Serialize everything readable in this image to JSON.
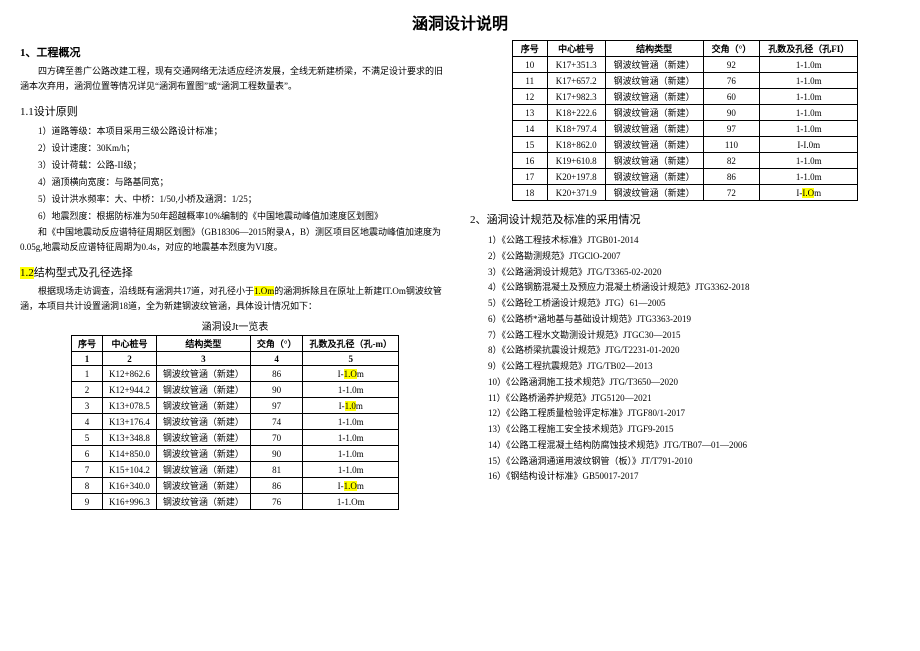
{
  "title": "涵洞设计说明",
  "left": {
    "sec1_h": "1、工程概况",
    "sec1_p1": "四方碑至善广公路改建工程，现有交通网络无法适应经济发展，全线无新建桥梁，不满足设计要求的旧涵本次弃用，涵洞位置等情况详见“涵洞布置图”或“涵洞工程数量表”。",
    "sec11_h": "1.1设计原则",
    "sec11_items": [
      "1）道路等级：本项目采用三级公路设计标准；",
      "2）设计速度：30Km/h；",
      "3）设计荷载：公路-II级；",
      "4）涵顶横向宽度：与路基同宽；",
      "5）设计洪水频率：大、中桥：1/50,小桥及涵洞：1/25；",
      "6）地震烈度：根据防标准为50年超越概率10%编制的《中国地震动峰值加速度区划图》"
    ],
    "sec11_p2": "和《中国地震动反应谱特征周期区划图》（GB18306—2015附录A，B）测区项目区地震动峰值加速度为0.05g,地震动反应谱特征周期为0.4s，对应的地震基本烈度为VI度。",
    "sec12_h_pre": "1.2",
    "sec12_h": "结构型式及孔径选择",
    "sec12_p": "根据现场走访调查，沿线既有涵洞共17道，对孔径小于",
    "sec12_p_hl": "1.Om",
    "sec12_p2": "的涵洞拆除且在原址上新建IT.Om钢波纹管涵，本项目共计设置涵洞18道，全为新建钢波纹管涵，具体设计情况如下：",
    "table1_title": "涵洞设Jt一览表",
    "table1_headers": [
      "序号",
      "中心桩号",
      "结构类型",
      "交角（°）",
      "孔数及孔径（孔-m）"
    ],
    "table1_sub": [
      "1",
      "2",
      "3",
      "4",
      "5"
    ],
    "table1_rows": [
      {
        "n": "1",
        "s": "K12+862.6",
        "t": "钢波纹管涵（新建）",
        "a": "86",
        "k": "I-1.Om",
        "hl": true
      },
      {
        "n": "2",
        "s": "K12+944.2",
        "t": "钢波纹管涵（新建）",
        "a": "90",
        "k": "1-1.0m"
      },
      {
        "n": "3",
        "s": "K13+078.5",
        "t": "钢波纹管涵（新建）",
        "a": "97",
        "k": "I-1.0m",
        "hl": true
      },
      {
        "n": "4",
        "s": "K13+176.4",
        "t": "钢波纹管涵（新建）",
        "a": "74",
        "k": "1-1.0m"
      },
      {
        "n": "5",
        "s": "K13+348.8",
        "t": "钢波纹管涵（新建）",
        "a": "70",
        "k": "1-1.0m"
      },
      {
        "n": "6",
        "s": "K14+850.0",
        "t": "钢波纹管涵（新建）",
        "a": "90",
        "k": "1-1.0m"
      },
      {
        "n": "7",
        "s": "K15+104.2",
        "t": "钢波纹管涵（新建）",
        "a": "81",
        "k": "1-1.0m"
      },
      {
        "n": "8",
        "s": "K16+340.0",
        "t": "钢波纹管涵（新建）",
        "a": "86",
        "k": "I-1.Om",
        "hl": true
      },
      {
        "n": "9",
        "s": "K16+996.3",
        "t": "钢波纹管涵（新建）",
        "a": "76",
        "k": "1-1.Om"
      }
    ]
  },
  "right": {
    "table2_headers": [
      "序号",
      "中心桩号",
      "结构类型",
      "交角（°）",
      "孔数及孔径（孔FI）"
    ],
    "table2_rows": [
      {
        "n": "10",
        "s": "K17+351.3",
        "t": "钢波纹管涵（新建）",
        "a": "92",
        "k": "1-1.0m"
      },
      {
        "n": "11",
        "s": "K17+657.2",
        "t": "钢波纹管涵（新建）",
        "a": "76",
        "k": "1-1.0m"
      },
      {
        "n": "12",
        "s": "K17+982.3",
        "t": "钢波纹管涵（新建）",
        "a": "60",
        "k": "1-1.0m"
      },
      {
        "n": "13",
        "s": "K18+222.6",
        "t": "钢波纹管涵（新建）",
        "a": "90",
        "k": "1-1.0m"
      },
      {
        "n": "14",
        "s": "K18+797.4",
        "t": "钢波纹管涵（新建）",
        "a": "97",
        "k": "1-1.0m"
      },
      {
        "n": "15",
        "s": "K18+862.0",
        "t": "钢波纹管涵（新建）",
        "a": "110",
        "k": "I-I.0m"
      },
      {
        "n": "16",
        "s": "K19+610.8",
        "t": "钢波纹管涵（新建）",
        "a": "82",
        "k": "1-1.0m"
      },
      {
        "n": "17",
        "s": "K20+197.8",
        "t": "钢波纹管涵（新建）",
        "a": "86",
        "k": "1-1.0m"
      },
      {
        "n": "18",
        "s": "K20+371.9",
        "t": "钢波纹管涵（新建）",
        "a": "72",
        "k": "I-I.Om",
        "hl": true
      }
    ],
    "sec2_h": "2、涵洞设计规范及标准的采用情况",
    "specs": [
      "1）《公路工程技术标准》JTGB01-2014",
      "2）《公路勘测规范》JTGClO-2007",
      "3）《公路涵洞设计规范》JTG/T3365-02-2020",
      "4）《公路钢筋混凝土及预应力混凝土桥涵设计规范》JTG3362-2018",
      "5）《公路砼工桥涵设计规范》JTG）61—2005",
      "6）《公路桥*涵地基与基础设计规范》JTG3363-2019",
      "7）《公路工程水文勘测设计规范》JTGC30—2015",
      "8）《公路桥梁抗震设计规范》JTG/T2231-01-2020",
      "9）《公路工程抗震规范》JTG/TB02—2013",
      "10）《公路涵洞施工技术规范》JTG/T3650—2020",
      "11）《公路桥涵养护规范》JTG5120—2021",
      "12）《公路工程质量检验评定标准》JTGF80/1-2017",
      "13）《公路工程施工安全技术规范》JTGF9-2015",
      "14）《公路工程混凝土结构防腐蚀技术规范》JTG/TB07—01—2006",
      "15）《公路涵洞通道用波纹钢管（板）》JT/T791-2010",
      "16）《钢结构设计标准》GB50017-2017"
    ]
  }
}
